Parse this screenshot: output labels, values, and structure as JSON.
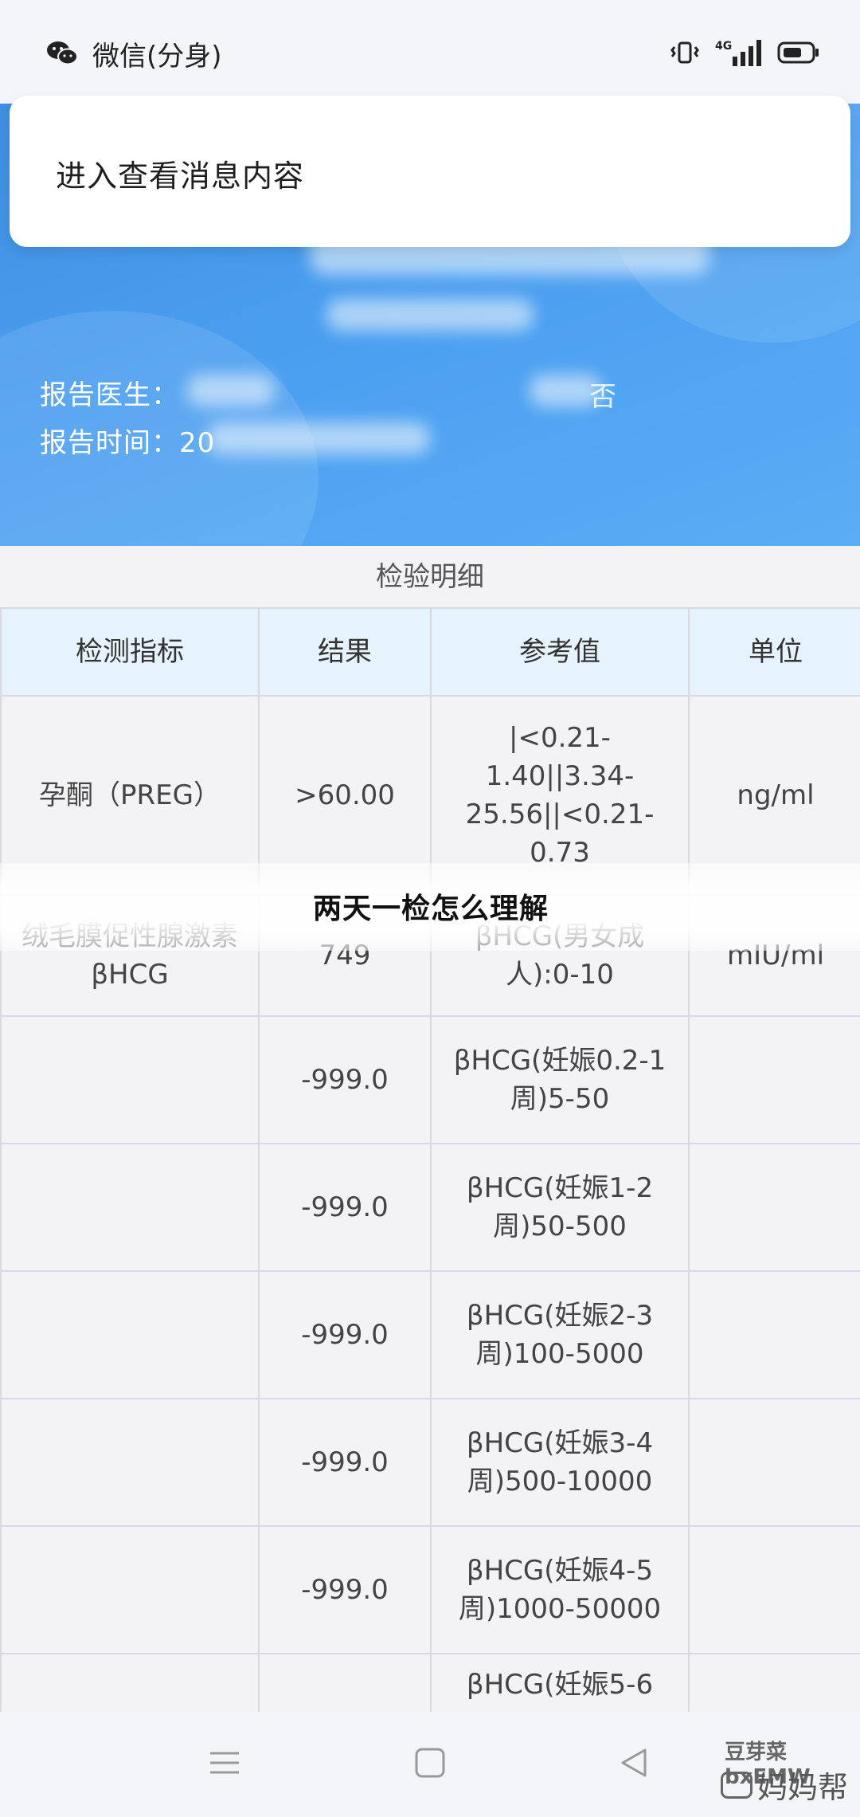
{
  "status_bar": {
    "app_name": "微信(分身)",
    "network": "4G",
    "icons": [
      "wechat-icon",
      "vibrate-icon",
      "signal-icon",
      "battery-icon"
    ]
  },
  "notification": {
    "text": "进入查看消息内容"
  },
  "header": {
    "doctor_label": "报告医生：",
    "time_label": "报告时间：20",
    "right_text": "否"
  },
  "section": {
    "title": "检验明细"
  },
  "table": {
    "headers": [
      "检测指标",
      "结果",
      "参考值",
      "单位"
    ],
    "rows": [
      {
        "indicator": "孕酮（PREG）",
        "result": ">60.00",
        "reference": "|<0.21-1.40||3.34-25.56||<0.21-0.73",
        "unit": "ng/ml"
      },
      {
        "indicator": "绒毛膜促性腺激素βHCG",
        "result": "749",
        "reference": "βHCG(男女成人):0-10",
        "unit": "mIU/ml"
      },
      {
        "indicator": "",
        "result": "-999.0",
        "reference": "βHCG(妊娠0.2-1周)5-50",
        "unit": ""
      },
      {
        "indicator": "",
        "result": "-999.0",
        "reference": "βHCG(妊娠1-2周)50-500",
        "unit": ""
      },
      {
        "indicator": "",
        "result": "-999.0",
        "reference": "βHCG(妊娠2-3周)100-5000",
        "unit": ""
      },
      {
        "indicator": "",
        "result": "-999.0",
        "reference": "βHCG(妊娠3-4周)500-10000",
        "unit": ""
      },
      {
        "indicator": "",
        "result": "-999.0",
        "reference": "βHCG(妊娠4-5周)1000-50000",
        "unit": ""
      },
      {
        "indicator": "",
        "result": "",
        "reference": "βHCG(妊娠5-6",
        "unit": ""
      }
    ]
  },
  "article_title": "两天一检怎么理解",
  "nav": {
    "icons": [
      "menu-icon",
      "home-square-icon",
      "back-triangle-icon"
    ]
  },
  "watermark": {
    "line1": "豆芽菜bxEMW",
    "line2": "妈妈帮"
  },
  "colors": {
    "header_blue": "#4a9ef0",
    "table_header_bg": "#e6f3fc",
    "page_bg": "#f3f3f5"
  }
}
